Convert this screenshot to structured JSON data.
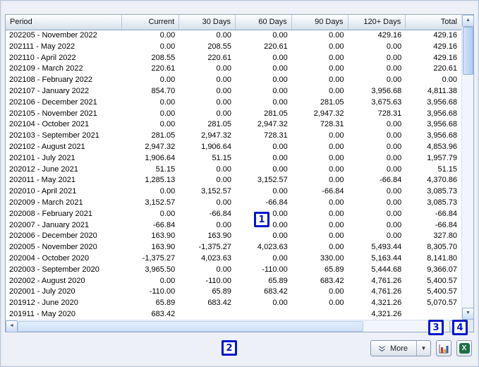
{
  "table": {
    "columns": [
      {
        "label": "Period",
        "align": "left"
      },
      {
        "label": "Current",
        "align": "right"
      },
      {
        "label": "30 Days",
        "align": "right"
      },
      {
        "label": "60 Days",
        "align": "right"
      },
      {
        "label": "90 Days",
        "align": "right"
      },
      {
        "label": "120+ Days",
        "align": "right"
      },
      {
        "label": "Total",
        "align": "right"
      }
    ],
    "rows": [
      [
        "202205 - November 2022",
        "0.00",
        "0.00",
        "0.00",
        "0.00",
        "429.16",
        "429.16"
      ],
      [
        "202111 - May 2022",
        "0.00",
        "208.55",
        "220.61",
        "0.00",
        "0.00",
        "429.16"
      ],
      [
        "202110 - April 2022",
        "208.55",
        "220.61",
        "0.00",
        "0.00",
        "0.00",
        "429.16"
      ],
      [
        "202109 - March 2022",
        "220.61",
        "0.00",
        "0.00",
        "0.00",
        "0.00",
        "220.61"
      ],
      [
        "202108 - February 2022",
        "0.00",
        "0.00",
        "0.00",
        "0.00",
        "0.00",
        "0.00"
      ],
      [
        "202107 - January 2022",
        "854.70",
        "0.00",
        "0.00",
        "0.00",
        "3,956.68",
        "4,811.38"
      ],
      [
        "202106 - December 2021",
        "0.00",
        "0.00",
        "0.00",
        "281.05",
        "3,675.63",
        "3,956.68"
      ],
      [
        "202105 - November 2021",
        "0.00",
        "0.00",
        "281.05",
        "2,947.32",
        "728.31",
        "3,956.68"
      ],
      [
        "202104 - October 2021",
        "0.00",
        "281.05",
        "2,947.32",
        "728.31",
        "0.00",
        "3,956.68"
      ],
      [
        "202103 - September 2021",
        "281.05",
        "2,947.32",
        "728.31",
        "0.00",
        "0.00",
        "3,956.68"
      ],
      [
        "202102 - August 2021",
        "2,947.32",
        "1,906.64",
        "0.00",
        "0.00",
        "0.00",
        "4,853.96"
      ],
      [
        "202101 - July 2021",
        "1,906.64",
        "51.15",
        "0.00",
        "0.00",
        "0.00",
        "1,957.79"
      ],
      [
        "202012 - June 2021",
        "51.15",
        "0.00",
        "0.00",
        "0.00",
        "0.00",
        "51.15"
      ],
      [
        "202011 - May 2021",
        "1,285.13",
        "0.00",
        "3,152.57",
        "0.00",
        "-66.84",
        "4,370.86"
      ],
      [
        "202010 - April 2021",
        "0.00",
        "3,152.57",
        "0.00",
        "-66.84",
        "0.00",
        "3,085.73"
      ],
      [
        "202009 - March 2021",
        "3,152.57",
        "0.00",
        "-66.84",
        "0.00",
        "0.00",
        "3,085.73"
      ],
      [
        "202008 - February 2021",
        "0.00",
        "-66.84",
        "0.00",
        "0.00",
        "0.00",
        "-66.84"
      ],
      [
        "202007 - January 2021",
        "-66.84",
        "0.00",
        "0.00",
        "0.00",
        "0.00",
        "-66.84"
      ],
      [
        "202006 - December 2020",
        "163.90",
        "163.90",
        "0.00",
        "0.00",
        "0.00",
        "327.80"
      ],
      [
        "202005 - November 2020",
        "163.90",
        "-1,375.27",
        "4,023.63",
        "0.00",
        "5,493.44",
        "8,305.70"
      ],
      [
        "202004 - October 2020",
        "-1,375.27",
        "4,023.63",
        "0.00",
        "330.00",
        "5,163.44",
        "8,141.80"
      ],
      [
        "202003 - September 2020",
        "3,965.50",
        "0.00",
        "-110.00",
        "65.89",
        "5,444.68",
        "9,366.07"
      ],
      [
        "202002 - August 2020",
        "0.00",
        "-110.00",
        "65.89",
        "683.42",
        "4,761.26",
        "5,400.57"
      ],
      [
        "202001 - July 2020",
        "-110.00",
        "65.89",
        "683.42",
        "0.00",
        "4,761.26",
        "5,400.57"
      ],
      [
        "201912 - June 2020",
        "65.89",
        "683.42",
        "0.00",
        "0.00",
        "4,321.26",
        "5,070.57"
      ],
      [
        "201911 - May 2020",
        "683.42",
        "",
        "",
        "",
        "4,321.26",
        ""
      ]
    ]
  },
  "toolbar": {
    "more_label": "More",
    "dropdown_glyph": "▼",
    "chart_icon": "bar-chart",
    "excel_icon": "excel-export",
    "excel_letter": "X"
  },
  "scrollbars": {
    "up_glyph": "▲",
    "down_glyph": "▼",
    "left_glyph": "◄",
    "right_glyph": "►"
  },
  "annotations": {
    "labels": [
      "1",
      "2",
      "3",
      "4"
    ]
  },
  "colors": {
    "annotation_blue": "#0018c8",
    "excel_green": "#1e7145",
    "chart_bar_red": "#c03a2b",
    "chart_bar_blue": "#2e5fb8",
    "chart_bar_yellow": "#e2a62f",
    "header_border": "#90a6c2"
  }
}
